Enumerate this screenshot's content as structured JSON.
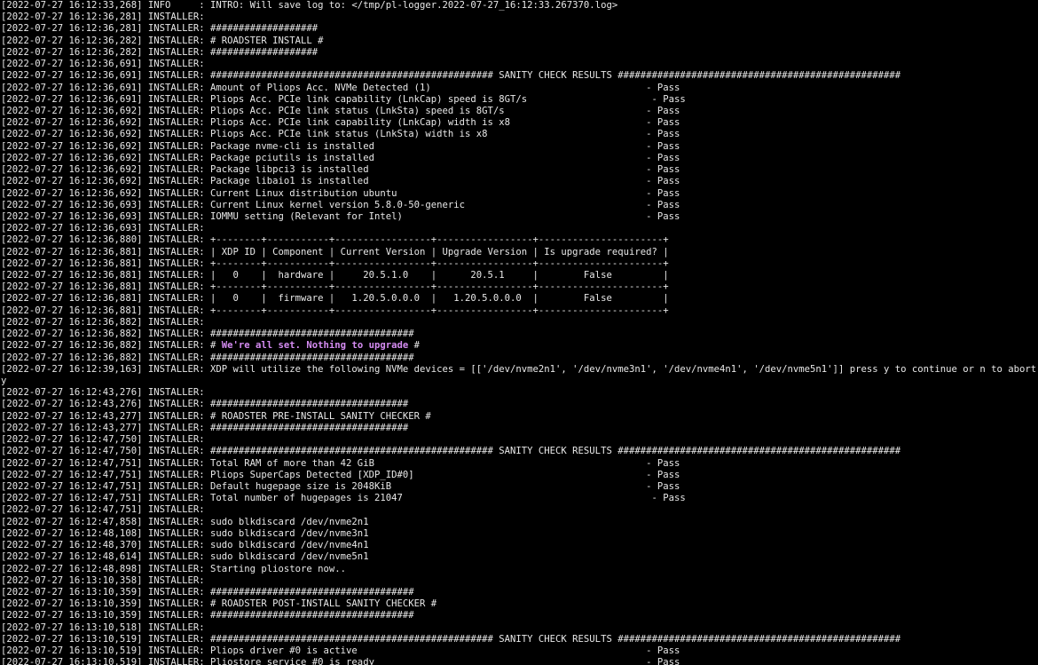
{
  "terminal": {
    "highlight_color": "#d58cf2",
    "text_color": "#e8e8e8",
    "background": "#000000",
    "lines": [
      {
        "pre": "[2022-07-27 16:12:33,268] INFO     : INTRO: Will save log to: </tmp/pl-logger.2022-07-27_16:12:33.267370.log>"
      },
      {
        "pre": "[2022-07-27 16:12:36,281] INSTALLER:"
      },
      {
        "pre": "[2022-07-27 16:12:36,281] INSTALLER: ###################"
      },
      {
        "pre": "[2022-07-27 16:12:36,282] INSTALLER: # ROADSTER INSTALL #"
      },
      {
        "pre": "[2022-07-27 16:12:36,282] INSTALLER: ###################"
      },
      {
        "pre": "[2022-07-27 16:12:36,691] INSTALLER:"
      },
      {
        "pre": "[2022-07-27 16:12:36,691] INSTALLER: ################################################## SANITY CHECK RESULTS ##################################################"
      },
      {
        "pre": "[2022-07-27 16:12:36,691] INSTALLER: Amount of Pliops Acc. NVMe Detected (1)                                      - Pass"
      },
      {
        "pre": "[2022-07-27 16:12:36,691] INSTALLER: Pliops Acc. PCIe link capability (LnkCap) speed is 8GT/s                      - Pass"
      },
      {
        "pre": "[2022-07-27 16:12:36,692] INSTALLER: Pliops Acc. PCIe link status (LnkSta) speed is 8GT/s                         - Pass"
      },
      {
        "pre": "[2022-07-27 16:12:36,692] INSTALLER: Pliops Acc. PCIe link capability (LnkCap) width is x8                        - Pass"
      },
      {
        "pre": "[2022-07-27 16:12:36,692] INSTALLER: Pliops Acc. PCIe link status (LnkSta) width is x8                            - Pass"
      },
      {
        "pre": "[2022-07-27 16:12:36,692] INSTALLER: Package nvme-cli is installed                                                - Pass"
      },
      {
        "pre": "[2022-07-27 16:12:36,692] INSTALLER: Package pciutils is installed                                                - Pass"
      },
      {
        "pre": "[2022-07-27 16:12:36,692] INSTALLER: Package libpci3 is installed                                                 - Pass"
      },
      {
        "pre": "[2022-07-27 16:12:36,692] INSTALLER: Package libaio1 is installed                                                 - Pass"
      },
      {
        "pre": "[2022-07-27 16:12:36,692] INSTALLER: Current Linux distribution ubuntu                                            - Pass"
      },
      {
        "pre": "[2022-07-27 16:12:36,693] INSTALLER: Current Linux kernel version 5.8.0-50-generic                                - Pass"
      },
      {
        "pre": "[2022-07-27 16:12:36,693] INSTALLER: IOMMU setting (Relevant for Intel)                                           - Pass"
      },
      {
        "pre": "[2022-07-27 16:12:36,693] INSTALLER:"
      },
      {
        "pre": "[2022-07-27 16:12:36,880] INSTALLER: +--------+-----------+-----------------+-----------------+----------------------+"
      },
      {
        "pre": "[2022-07-27 16:12:36,881] INSTALLER: | XDP ID | Component | Current Version | Upgrade Version | Is upgrade required? |"
      },
      {
        "pre": "[2022-07-27 16:12:36,881] INSTALLER: +--------+-----------+-----------------+-----------------+----------------------+"
      },
      {
        "pre": "[2022-07-27 16:12:36,881] INSTALLER: |   0    |  hardware |     20.5.1.0    |      20.5.1     |        False         |"
      },
      {
        "pre": "[2022-07-27 16:12:36,881] INSTALLER: +--------+-----------+-----------------+-----------------+----------------------+"
      },
      {
        "pre": "[2022-07-27 16:12:36,881] INSTALLER: |   0    |  firmware |   1.20.5.0.0.0  |   1.20.5.0.0.0  |        False         |"
      },
      {
        "pre": "[2022-07-27 16:12:36,881] INSTALLER: +--------+-----------+-----------------+-----------------+----------------------+"
      },
      {
        "pre": "[2022-07-27 16:12:36,882] INSTALLER:"
      },
      {
        "pre": "[2022-07-27 16:12:36,882] INSTALLER: ####################################"
      },
      {
        "pre": "[2022-07-27 16:12:36,882] INSTALLER: # ",
        "hl": "We're all set. Nothing to upgrade",
        "post": " #"
      },
      {
        "pre": "[2022-07-27 16:12:36,882] INSTALLER: ####################################"
      },
      {
        "pre": "[2022-07-27 16:12:39,163] INSTALLER: XDP will utilize the following NVMe devices = [['/dev/nvme2n1', '/dev/nvme3n1', '/dev/nvme4n1', '/dev/nvme5n1']] press y to continue or n to abort."
      },
      {
        "pre": "y"
      },
      {
        "pre": "[2022-07-27 16:12:43,276] INSTALLER:"
      },
      {
        "pre": "[2022-07-27 16:12:43,276] INSTALLER: ###################################"
      },
      {
        "pre": "[2022-07-27 16:12:43,277] INSTALLER: # ROADSTER PRE-INSTALL SANITY CHECKER #"
      },
      {
        "pre": "[2022-07-27 16:12:43,277] INSTALLER: ###################################"
      },
      {
        "pre": "[2022-07-27 16:12:47,750] INSTALLER:"
      },
      {
        "pre": "[2022-07-27 16:12:47,750] INSTALLER: ################################################## SANITY CHECK RESULTS ##################################################"
      },
      {
        "pre": "[2022-07-27 16:12:47,751] INSTALLER: Total RAM of more than 42 GiB                                                - Pass"
      },
      {
        "pre": "[2022-07-27 16:12:47,751] INSTALLER: Pliops SuperCaps Detected [XDP_ID#0]                                         - Pass"
      },
      {
        "pre": "[2022-07-27 16:12:47,751] INSTALLER: Default hugepage size is 2048KiB                                             - Pass"
      },
      {
        "pre": "[2022-07-27 16:12:47,751] INSTALLER: Total number of hugepages is 21047                                            - Pass"
      },
      {
        "pre": "[2022-07-27 16:12:47,751] INSTALLER:"
      },
      {
        "pre": "[2022-07-27 16:12:47,858] INSTALLER: sudo blkdiscard /dev/nvme2n1"
      },
      {
        "pre": "[2022-07-27 16:12:48,108] INSTALLER: sudo blkdiscard /dev/nvme3n1"
      },
      {
        "pre": "[2022-07-27 16:12:48,370] INSTALLER: sudo blkdiscard /dev/nvme4n1"
      },
      {
        "pre": "[2022-07-27 16:12:48,614] INSTALLER: sudo blkdiscard /dev/nvme5n1"
      },
      {
        "pre": "[2022-07-27 16:12:48,898] INSTALLER: Starting pliostore now.."
      },
      {
        "pre": "[2022-07-27 16:13:10,358] INSTALLER:"
      },
      {
        "pre": "[2022-07-27 16:13:10,359] INSTALLER: ####################################"
      },
      {
        "pre": "[2022-07-27 16:13:10,359] INSTALLER: # ROADSTER POST-INSTALL SANITY CHECKER #"
      },
      {
        "pre": "[2022-07-27 16:13:10,359] INSTALLER: ####################################"
      },
      {
        "pre": "[2022-07-27 16:13:10,518] INSTALLER:"
      },
      {
        "pre": "[2022-07-27 16:13:10,519] INSTALLER: ################################################## SANITY CHECK RESULTS ##################################################"
      },
      {
        "pre": "[2022-07-27 16:13:10,519] INSTALLER: Pliops driver #0 is active                                                   - Pass"
      },
      {
        "pre": "[2022-07-27 16:13:10,519] INSTALLER: Pliostore service #0 is ready                                                - Pass"
      }
    ]
  }
}
